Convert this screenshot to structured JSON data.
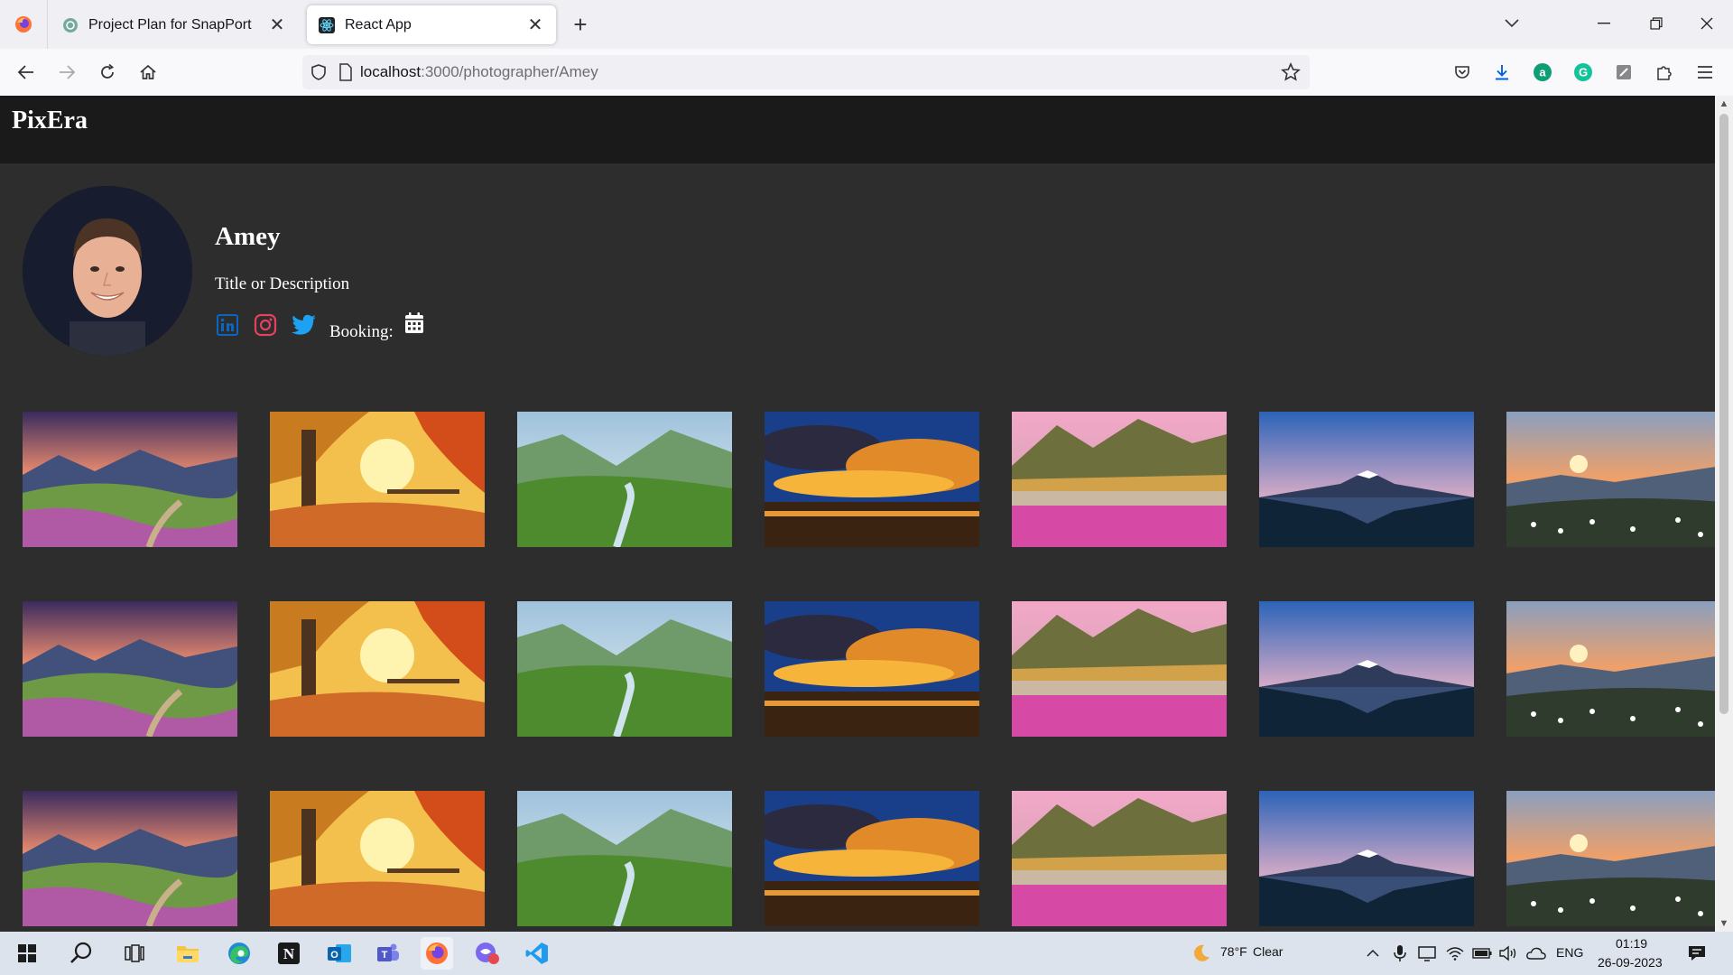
{
  "browser": {
    "tabs": [
      {
        "title": "Project Plan for SnapPort",
        "active": false
      },
      {
        "title": "React App",
        "active": true
      }
    ],
    "url_host": "localhost",
    "url_path": ":3000/photographer/Amey"
  },
  "app": {
    "brand": "PixEra"
  },
  "profile": {
    "name": "Amey",
    "description": "Title or Description",
    "booking_label": "Booking:",
    "social_icons": [
      "linkedin-icon",
      "instagram-icon",
      "twitter-icon",
      "calendar-icon"
    ]
  },
  "gallery": {
    "rows": 3,
    "columns": 7,
    "images": [
      "valley-flowers-sunset",
      "autumn-park-bridge",
      "green-valley-stream",
      "lake-sunset-clouds",
      "mountain-pink-flowers",
      "snow-peak-lake-reflection",
      "mountain-sunrise-daisies"
    ]
  },
  "taskbar": {
    "weather_temp": "78°F",
    "weather_desc": "Clear",
    "language": "ENG",
    "time": "01:19",
    "date": "26-09-2023"
  },
  "colors": {
    "page_bg": "#2d2d2d",
    "header_bg": "#1a1a1a",
    "linkedin": "#0a66c2",
    "instagram": "#e4405f",
    "twitter": "#1da1f2"
  }
}
